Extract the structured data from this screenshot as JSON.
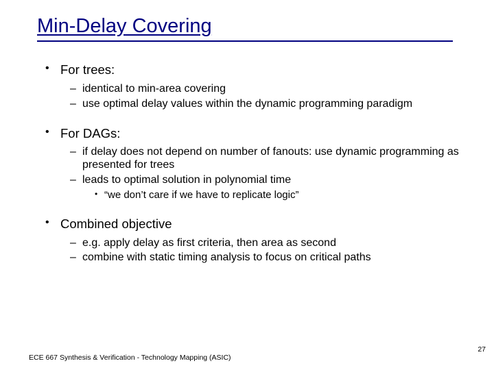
{
  "title": "Min-Delay Covering",
  "bullets": {
    "b1": {
      "label": "For trees:",
      "sub": {
        "s1": "identical to min-area covering",
        "s2": "use optimal delay values within the dynamic programming paradigm"
      }
    },
    "b2": {
      "label": "For DAGs:",
      "sub": {
        "s1": "if delay does not depend on number of fanouts: use dynamic programming as presented for trees",
        "s2": "leads to optimal solution in polynomial time",
        "s2sub": {
          "q1": "“we don’t care if we have to replicate logic”"
        }
      }
    },
    "b3": {
      "label": "Combined objective",
      "sub": {
        "s1": "e.g. apply delay as first criteria, then area as second",
        "s2": "combine with static timing analysis to focus on critical paths"
      }
    }
  },
  "footer": "ECE 667 Synthesis & Verification - Technology Mapping (ASIC)",
  "page": "27"
}
